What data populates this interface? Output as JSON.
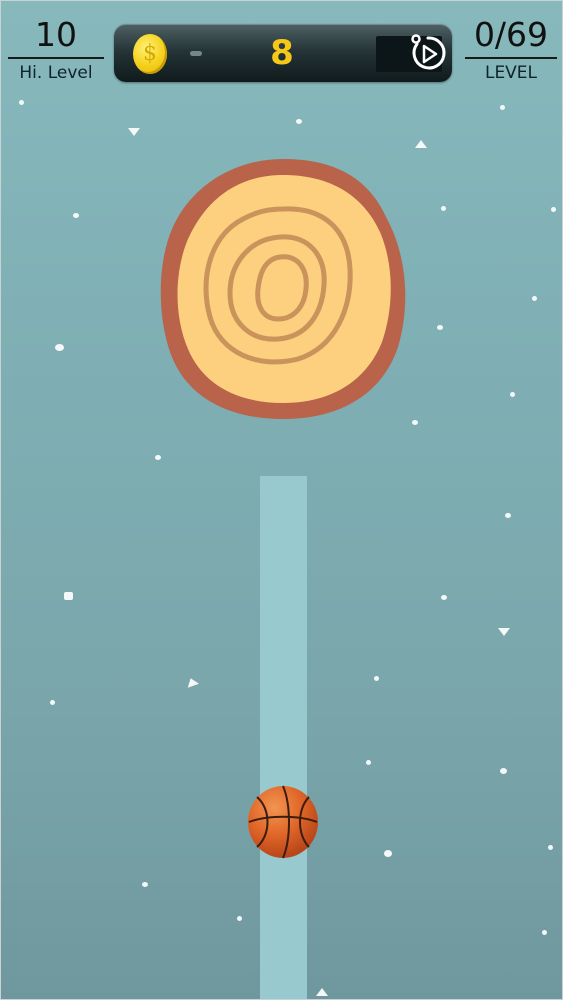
{
  "hud": {
    "high_level": {
      "value": "10",
      "label": "Hi. Level"
    },
    "level": {
      "value": "0/69",
      "label": "LEVEL"
    },
    "coins": {
      "currency_symbol": "$",
      "count": "8"
    },
    "replay_icon": "replay-icon"
  },
  "game": {
    "target": "wood-log-target",
    "player": "basketball",
    "background_snow": true
  },
  "colors": {
    "background": "#7eaeb3",
    "track": "#98c9ce",
    "log_bark": "#b8634a",
    "log_wood": "#fcd07f",
    "log_rings": "#c9935b",
    "coin_count": "#f6c819",
    "ball": "#e26a2c"
  }
}
